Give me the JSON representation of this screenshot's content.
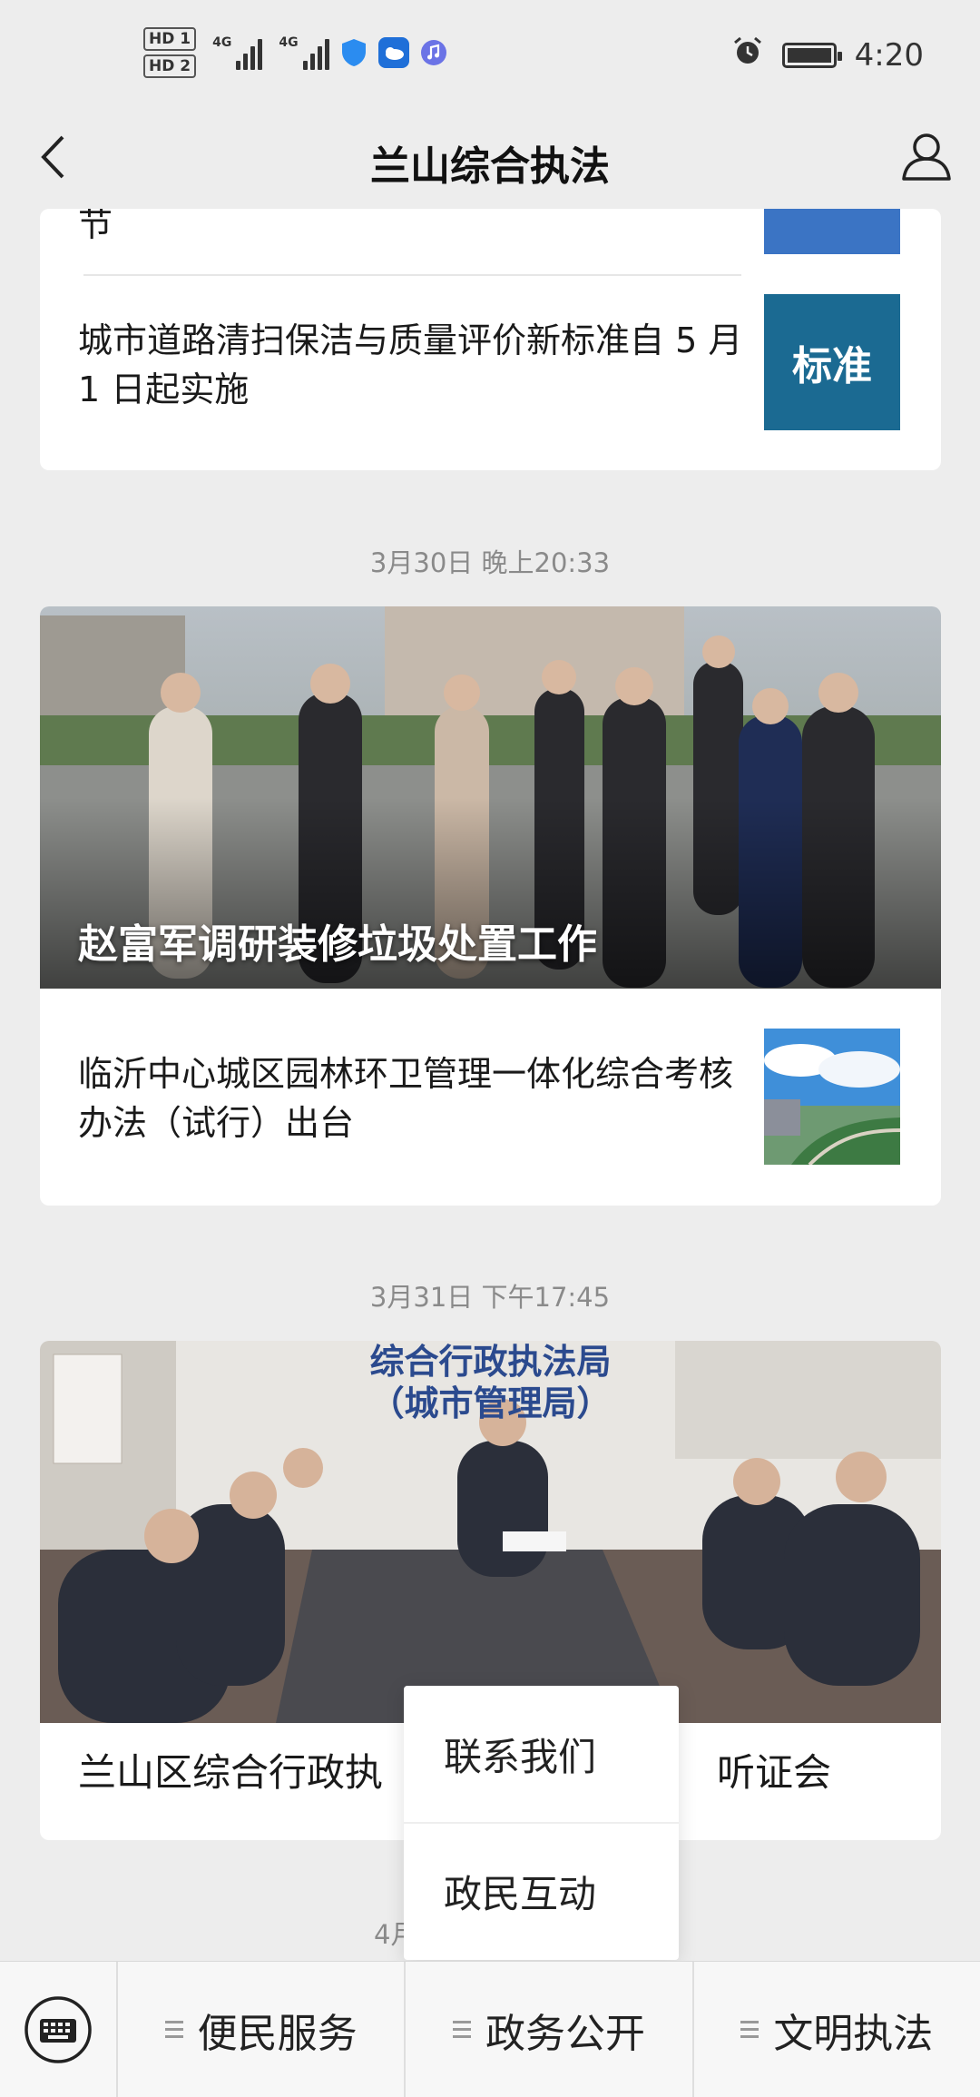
{
  "status_bar": {
    "hd1": "HD 1",
    "hd2": "HD 2",
    "net1": "4G",
    "net2": "4G",
    "time": "4:20"
  },
  "nav": {
    "title": "兰山综合执法"
  },
  "feed": {
    "partial_title": "节",
    "article1": {
      "title": "城市道路清扫保洁与质量评价新标准自 5 月 1 日起实施",
      "thumb_text": "标准"
    },
    "date2": "3月30日 晚上20:33",
    "hero1_caption": "赵富军调研装修垃圾处置工作",
    "article2": {
      "title": "临沂中心城区园林环卫管理一体化综合考核办法（试行）出台"
    },
    "date3": "3月31日 下午17:45",
    "hero2_banner_line1": "综合行政执法局",
    "hero2_banner_line2": "（城市管理局）",
    "article3_left": "兰山区综合行政执",
    "article3_right": "听证会",
    "date4_partial": "4月"
  },
  "popup": {
    "items": [
      "联系我们",
      "政民互动"
    ]
  },
  "bottom_menu": {
    "items": [
      "便民服务",
      "政务公开",
      "文明执法"
    ]
  },
  "colors": {
    "background": "#ededed",
    "card": "#ffffff",
    "date_text": "#8a8a8a",
    "thumb_blue": "#1b6a92"
  }
}
